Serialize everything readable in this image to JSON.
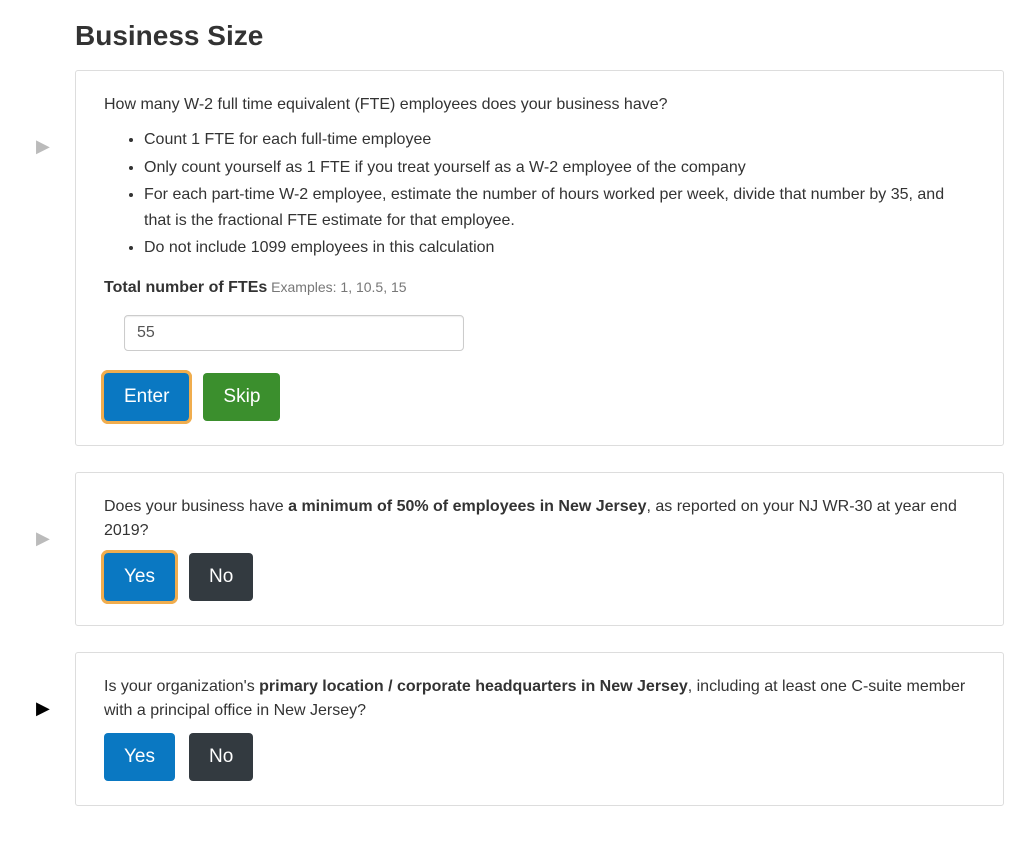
{
  "title": "Business Size",
  "q1": {
    "question": "How many W-2 full time equivalent (FTE) employees does your business have?",
    "bullets": [
      "Count 1 FTE for each full-time employee",
      "Only count yourself as 1 FTE if you treat yourself as a W-2 employee of the company",
      "For each part-time W-2 employee, estimate the number of hours worked per week, divide that number by 35, and that is the fractional FTE estimate for that employee.",
      "Do not include 1099 employees in this calculation"
    ],
    "label_strong": "Total number of FTEs",
    "label_examples": " Examples: 1, 10.5, 15",
    "input_value": "55",
    "enter": "Enter",
    "skip": "Skip"
  },
  "q2": {
    "prefix": "Does your business have ",
    "bold": "a minimum of 50% of employees in New Jersey",
    "suffix": ", as reported on your NJ WR-30 at year end 2019?",
    "yes": "Yes",
    "no": "No"
  },
  "q3": {
    "prefix": "Is your organization's ",
    "bold": "primary location / corporate headquarters in New Jersey",
    "suffix": ", including at least one C-suite member with a principal office in New Jersey?",
    "yes": "Yes",
    "no": "No"
  }
}
